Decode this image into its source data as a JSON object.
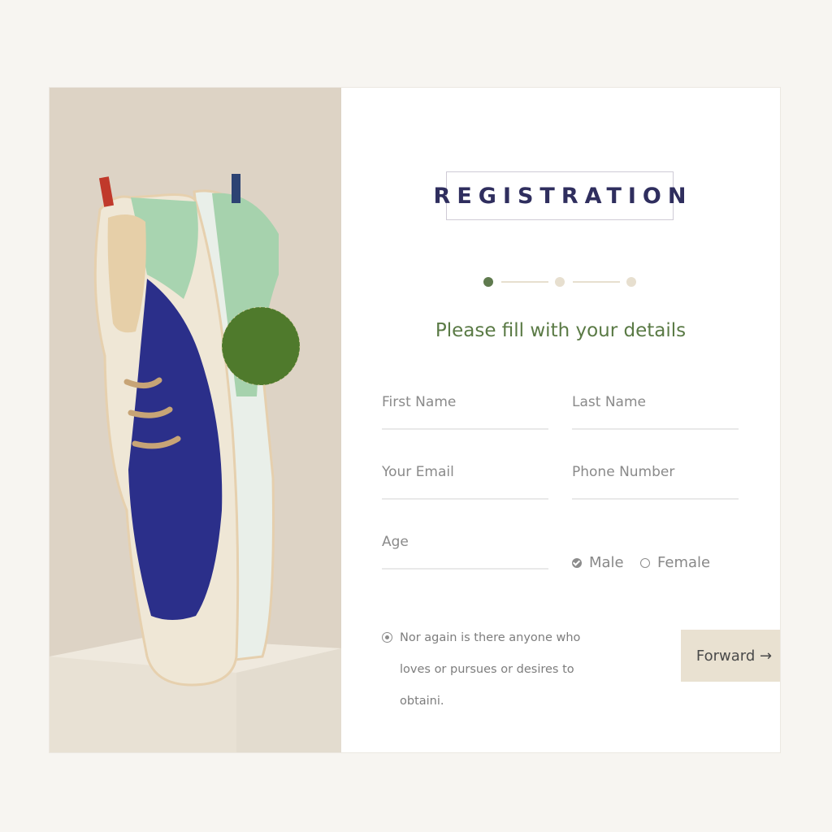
{
  "registration": {
    "title": "REGISTRATION",
    "subtitle": "Please fill with your details",
    "steps": [
      {
        "state": "active",
        "color": "#5f7a4e"
      },
      {
        "state": "inactive",
        "color": "#e7dfcf"
      },
      {
        "state": "inactive",
        "color": "#e7dfcf"
      }
    ],
    "fields": {
      "first_name": {
        "placeholder": "First Name",
        "value": ""
      },
      "last_name": {
        "placeholder": "Last Name",
        "value": ""
      },
      "email": {
        "placeholder": "Your Email",
        "value": ""
      },
      "phone": {
        "placeholder": "Phone Number",
        "value": ""
      },
      "age": {
        "placeholder": "Age",
        "value": ""
      }
    },
    "gender": {
      "options": [
        {
          "label": "Male",
          "selected": true
        },
        {
          "label": "Female",
          "selected": false
        }
      ]
    },
    "agreement": {
      "text": "Nor again is there anyone who loves or pursues or desires to obtaini.",
      "checked": true
    },
    "forward_button": {
      "label": "Forward →"
    }
  },
  "colors": {
    "page_bg": "#f7f5f1",
    "photo_bg": "#ddd3c5",
    "title": "#2f2e5e",
    "accent_green": "#5a7a45",
    "button_bg": "#e9e1d1"
  },
  "icons": [
    "check-circle-icon",
    "radio-empty-icon",
    "radio-dot-icon",
    "arrow-right-icon"
  ]
}
